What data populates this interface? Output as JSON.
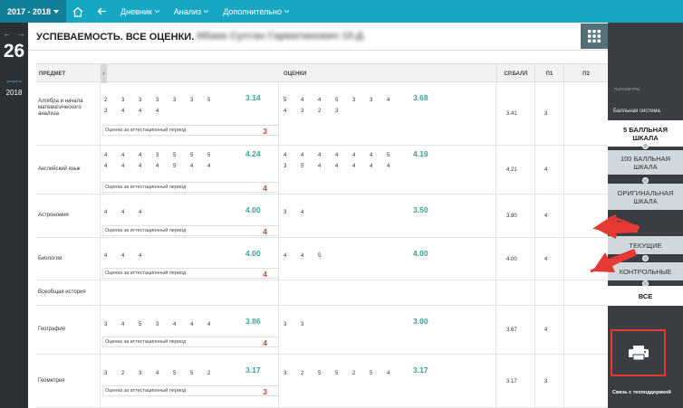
{
  "topbar": {
    "year_label": "2017 - 2018",
    "home_icon": "home-icon",
    "back_icon": "back-arrow-icon",
    "nav": [
      {
        "label": "Дневник"
      },
      {
        "label": "Анализ"
      },
      {
        "label": "Дополнительно"
      }
    ]
  },
  "left_panel": {
    "day": "26",
    "month": "февраля",
    "year": "2018"
  },
  "page": {
    "title": "УСПЕВАЕМОСТЬ. ВСЕ ОЦЕНКИ.",
    "student_name": "Ибаев Султан Гарматинович 10-Д"
  },
  "table": {
    "headers": {
      "subject": "ПРЕДМЕТ",
      "grades": "ОЦЕНКИ",
      "avg": "СР.БАЛЛ",
      "p1": "П1",
      "p2": "П2"
    },
    "attest_label": "Оценка за аттестационный период",
    "rows": [
      {
        "subject": "Алгебра и начала математического анализа",
        "g1": [
          "2",
          "3",
          "3",
          "3",
          "3",
          "3",
          "5"
        ],
        "g1b": [
          "3",
          "4",
          "4",
          "4"
        ],
        "avg1": "3.14",
        "g2": [
          "5",
          "4",
          "4",
          "5",
          "3",
          "3",
          "4"
        ],
        "g2b": [
          "4",
          "3",
          "2",
          "3"
        ],
        "avg2": "3.68",
        "attest": "3",
        "avg": "3.41",
        "p1": "3"
      },
      {
        "subject": "Английский язык",
        "g1": [
          "4",
          "4",
          "4",
          "3",
          "5",
          "5",
          "5"
        ],
        "g1b": [
          "4",
          "4",
          "4",
          "4",
          "5",
          "4",
          "4"
        ],
        "avg1": "4.24",
        "g2": [
          "4",
          "4",
          "4",
          "4",
          "4",
          "4",
          "5"
        ],
        "g2b": [
          "3",
          "5",
          "4",
          "4",
          "4",
          "4",
          "4"
        ],
        "avg2": "4.19",
        "attest": "4",
        "avg": "4.21",
        "p1": "4"
      },
      {
        "subject": "Астрономия",
        "g1": [
          "4",
          "4",
          "4"
        ],
        "g1b": [],
        "avg1": "4.00",
        "g2": [
          "3",
          "4"
        ],
        "g2b": [],
        "avg2": "3.50",
        "attest": "4",
        "avg": "3.80",
        "p1": "4"
      },
      {
        "subject": "Биология",
        "g1": [
          "4",
          "4",
          "4"
        ],
        "g1b": [],
        "avg1": "4.00",
        "g2": [
          "4",
          "4",
          "5"
        ],
        "g2b": [],
        "avg2": "4.00",
        "attest": "4",
        "avg": "4.00",
        "p1": "4"
      },
      {
        "subject": "Всеобщая история",
        "g1": [],
        "g1b": [],
        "avg1": "",
        "g2": [],
        "g2b": [],
        "avg2": "",
        "attest": "",
        "avg": "",
        "p1": ""
      },
      {
        "subject": "География",
        "g1": [
          "3",
          "4",
          "5",
          "3",
          "4",
          "4",
          "4"
        ],
        "g1b": [],
        "avg1": "3.86",
        "g2": [
          "3",
          "3"
        ],
        "g2b": [],
        "avg2": "3.00",
        "attest": "4",
        "avg": "3.67",
        "p1": "4"
      },
      {
        "subject": "Геометрия",
        "g1": [
          "3",
          "2",
          "3",
          "4",
          "5",
          "5",
          "2"
        ],
        "g1b": [],
        "avg1": "3.17",
        "g2": [
          "3",
          "2",
          "5",
          "5",
          "2",
          "5",
          "4"
        ],
        "g2b": [],
        "avg2": "3.17",
        "attest": "3",
        "avg": "3.17",
        "p1": "3"
      }
    ]
  },
  "right_panel": {
    "params_label": "ПАРАМЕТРЫ",
    "scale_label": "Балльная система",
    "scale_options": [
      "5 БАЛЛЬНАЯ ШКАЛА",
      "100 БАЛЛЬНАЯ ШКАЛА",
      "ОРИГИНАЛЬНАЯ ШКАЛА"
    ],
    "grades_label": "Оценки",
    "grade_options": [
      "ТЕКУЩИЕ",
      "КОНТРОЛЬНЫЕ",
      "ВСЕ"
    ],
    "print_icon": "printer-icon",
    "support_label": "Связь с техподдержкой"
  },
  "colors": {
    "accent": "#16a7c4",
    "avg_green": "#3aa497",
    "attest_red": "#e53935",
    "annotation_red": "#e53935"
  }
}
